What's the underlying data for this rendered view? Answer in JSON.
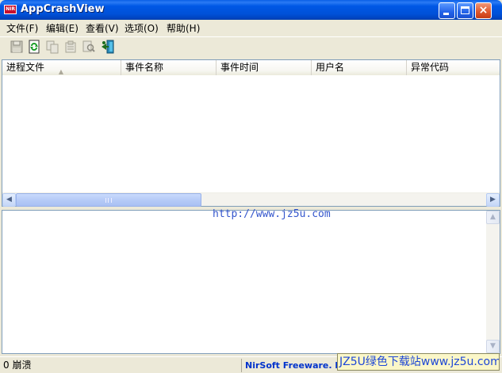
{
  "window": {
    "title": "AppCrashView",
    "icon_label": "NIR",
    "minimize_icon": "minimize-icon",
    "maximize_icon": "maximize-icon",
    "close_glyph": "×"
  },
  "menu": [
    {
      "label": "文件(F)"
    },
    {
      "label": "编辑(E)"
    },
    {
      "label": "查看(V)"
    },
    {
      "label": "选项(O)"
    },
    {
      "label": "帮助(H)"
    }
  ],
  "toolbar": [
    {
      "icon": "save-icon",
      "enabled": false
    },
    {
      "icon": "refresh-icon",
      "enabled": true
    },
    {
      "icon": "copy-icon",
      "enabled": false
    },
    {
      "icon": "properties-icon",
      "enabled": false
    },
    {
      "icon": "find-icon",
      "enabled": false
    },
    {
      "icon": "exit-icon",
      "enabled": true
    }
  ],
  "list": {
    "columns": [
      "进程文件",
      "事件名称",
      "事件时间",
      "用户名",
      "异常代码"
    ],
    "rows": [],
    "sort_indicator": "▲"
  },
  "hscroll": {
    "left_arrow": "◀",
    "right_arrow": "▶"
  },
  "lower_pane": {
    "url": "http://www.jz5u.com",
    "up_arrow": "▲",
    "down_arrow": "▼"
  },
  "status": {
    "left": "0 崩溃",
    "right": "NirSoft Freeware.  http://www.nirsoft.net"
  },
  "watermark": "JZ5U绿色下载站www.jz5u.com",
  "colors": {
    "titlebar": "#0054E3",
    "link": "#3355CC",
    "status_link": "#0033CC",
    "watermark_bg": "#FBF7C8"
  }
}
